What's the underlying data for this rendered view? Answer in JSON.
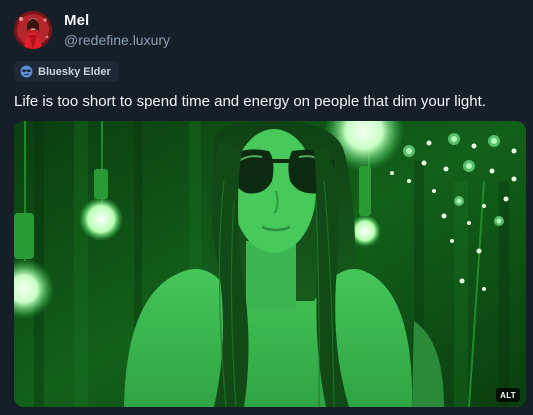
{
  "author": {
    "display_name": "Mel",
    "handle": "@redefine.luxury",
    "avatar_icon": "profile-photo-avatar"
  },
  "badge": {
    "label": "Bluesky Elder",
    "icon": "sunglasses-face-icon"
  },
  "post": {
    "text": "Life is too short to spend time and energy on people that dim your light."
  },
  "media": {
    "alt_label": "ALT",
    "tint_color": "#2fd64a"
  },
  "colors": {
    "background": "#161e27",
    "text_primary": "#f1f3f5",
    "text_secondary": "#8c9fb3",
    "badge_bg": "#1e2936"
  }
}
